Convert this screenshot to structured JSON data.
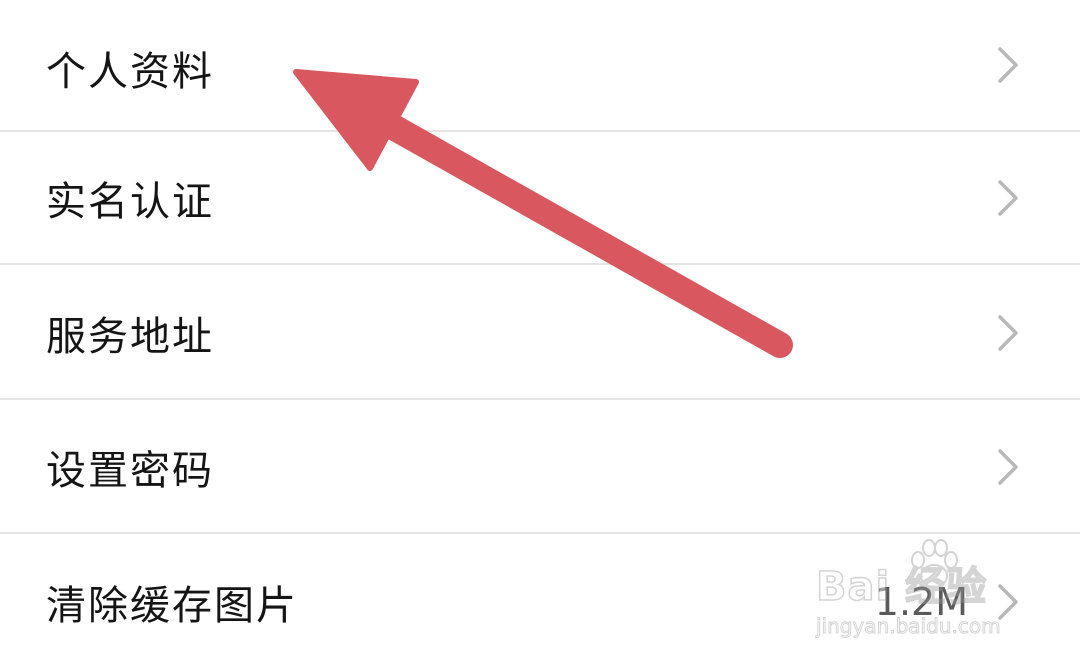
{
  "settings": {
    "items": [
      {
        "label": "个人资料",
        "value": "",
        "icon": "chevron-right-icon"
      },
      {
        "label": "实名认证",
        "value": "",
        "icon": "chevron-right-icon"
      },
      {
        "label": "服务地址",
        "value": "",
        "icon": "chevron-right-icon"
      },
      {
        "label": "设置密码",
        "value": "",
        "icon": "chevron-right-icon"
      },
      {
        "label": "清除缓存图片",
        "value": "1.2M",
        "icon": "chevron-right-icon"
      }
    ]
  },
  "annotation": {
    "arrow_color": "#d9575f",
    "points_to": "个人资料"
  },
  "watermark": {
    "brand": "Bai 经验",
    "url": "jingyan.baidu.com"
  },
  "colors": {
    "background": "#ffffff",
    "divider": "#e4e4e4",
    "label": "#151515",
    "chevron": "#b8b8b8",
    "value": "#5a5a5a"
  }
}
